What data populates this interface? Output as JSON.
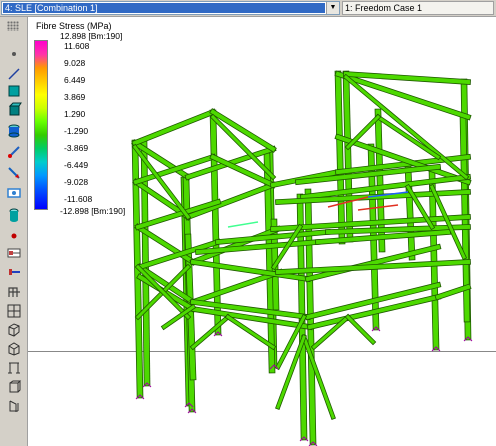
{
  "toolbar_top": {
    "combination_select": "4: SLE [Combination 1]",
    "case_label": "1: Freedom Case 1"
  },
  "legend": {
    "title": "Fibre Stress (MPa)",
    "labels": [
      "12.898 [Bm:190]",
      "11.608",
      "9.028",
      "6.449",
      "3.869",
      "1.290",
      "-1.290",
      "-3.869",
      "-6.449",
      "-9.028",
      "-11.608",
      "-12.898 [Bm:190]"
    ]
  },
  "tools": [
    {
      "name": "node-tool-icon"
    },
    {
      "name": "beam-tool-icon"
    },
    {
      "name": "plate-tool-icon"
    },
    {
      "name": "brick-tool-icon"
    },
    {
      "name": "cylinder-tool-icon"
    },
    {
      "name": "link-tool-icon"
    },
    {
      "name": "load-arrow-icon"
    },
    {
      "name": "section-view-icon"
    },
    {
      "name": "shell-tool-icon"
    },
    {
      "name": "point-tool-icon"
    },
    {
      "name": "member-release-icon"
    },
    {
      "name": "member-end-icon"
    },
    {
      "name": "frame-view-icon"
    },
    {
      "name": "grid-view-icon"
    },
    {
      "name": "perspective-view-icon"
    },
    {
      "name": "box-view-icon"
    },
    {
      "name": "support-icon"
    },
    {
      "name": "solid-view-icon"
    },
    {
      "name": "flip-view-icon"
    }
  ],
  "colors": {
    "toolbar_bg": "#d4d0c8",
    "selection_blue": "#316ac5",
    "member_green": "#4dd900",
    "member_dark": "#1f5a00"
  }
}
